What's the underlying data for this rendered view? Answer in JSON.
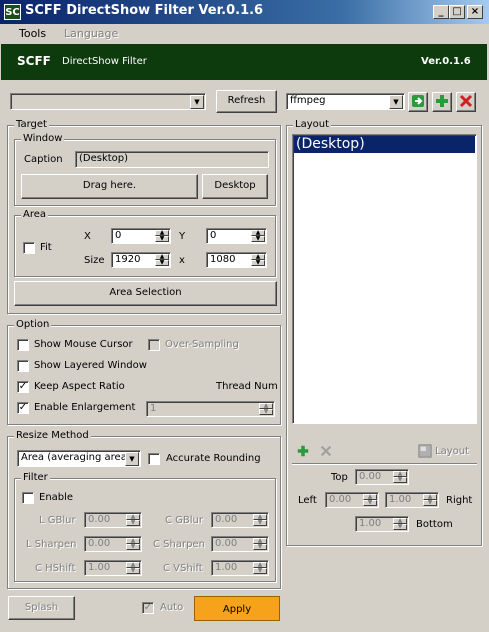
{
  "window": {
    "app_icon": "SC",
    "title": "SCFF DirectShow Filter Ver.0.1.6",
    "minimize": "_",
    "maximize": "□",
    "close": "×"
  },
  "menu": {
    "tools": "Tools",
    "language": "Language"
  },
  "header": {
    "brand": "SCFF",
    "subtitle": "DirectShow Filter",
    "version": "Ver.0.1.6"
  },
  "process": {
    "selected": "",
    "refresh_label": "Refresh"
  },
  "profile": {
    "selected": "ffmpeg"
  },
  "target": {
    "title": "Target",
    "window_title": "Window",
    "caption_label": "Caption",
    "caption_value": "(Desktop)",
    "drag_here": "Drag here.",
    "desktop_button": "Desktop",
    "area_title": "Area",
    "fit_label": "Fit",
    "fit_checked": false,
    "x_label": "X",
    "x_value": "0",
    "y_label": "Y",
    "y_value": "0",
    "size_label": "Size",
    "width_value": "1920",
    "times": "x",
    "height_value": "1080",
    "area_selection": "Area Selection"
  },
  "option": {
    "title": "Option",
    "show_mouse_cursor": "Show Mouse Cursor",
    "show_mouse_cursor_checked": false,
    "over_sampling": "Over-Sampling",
    "show_layered_window": "Show Layered Window",
    "show_layered_window_checked": false,
    "keep_aspect_ratio": "Keep Aspect Ratio",
    "keep_aspect_ratio_checked": true,
    "thread_num": "Thread Num",
    "enable_enlargement": "Enable Enlargement",
    "enable_enlargement_checked": true,
    "thread_num_value": "1"
  },
  "resize": {
    "title": "Resize Method",
    "method": "Area (averaging area)",
    "accurate_rounding": "Accurate Rounding",
    "accurate_rounding_checked": false,
    "filter_title": "Filter",
    "enable": "Enable",
    "enable_checked": false,
    "l_gblur": "L GBlur",
    "l_gblur_value": "0.00",
    "c_gblur": "C GBlur",
    "c_gblur_value": "0.00",
    "l_sharpen": "L Sharpen",
    "l_sharpen_value": "0.00",
    "c_sharpen": "C Sharpen",
    "c_sharpen_value": "0.00",
    "c_hshift": "C HShift",
    "c_hshift_value": "1.00",
    "c_vshift": "C VShift",
    "c_vshift_value": "1.00"
  },
  "layout": {
    "title": "Layout",
    "items": [
      "(Desktop)"
    ],
    "layout_button": "Layout",
    "top": "Top",
    "top_value": "0.00",
    "left": "Left",
    "left_value": "0.00",
    "right_value": "1.00",
    "right": "Right",
    "bottom_value": "1.00",
    "bottom": "Bottom"
  },
  "footer": {
    "splash": "Splash",
    "auto": "Auto",
    "auto_checked": true,
    "apply": "Apply"
  },
  "colors": {
    "title_bar": "#0a246a",
    "header_band": "#0d3b0d",
    "apply_button": "#f7a21b",
    "selection": "#0a246a"
  },
  "icons": {
    "go": "arrow-right-icon",
    "add": "plus-icon",
    "delete": "x-icon",
    "layout": "layout-icon",
    "spin_up": "▲",
    "spin_down": "▼",
    "dropdown": "▼",
    "check": "✓"
  }
}
